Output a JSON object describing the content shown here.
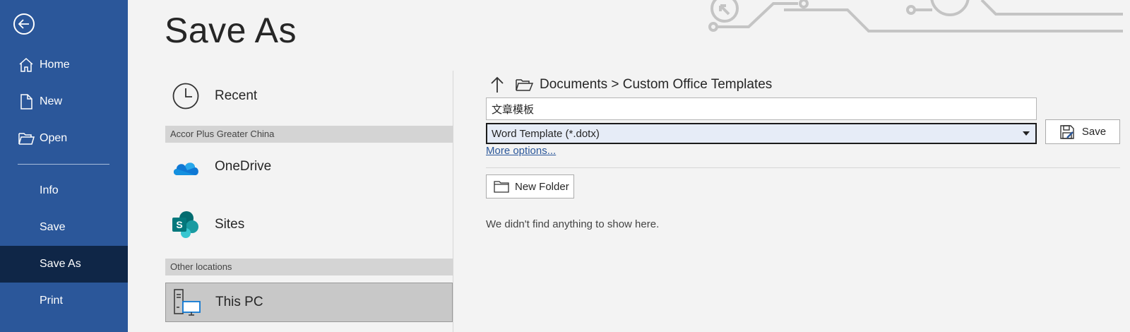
{
  "sidebar": {
    "items": [
      {
        "label": "Home",
        "icon": "home-icon"
      },
      {
        "label": "New",
        "icon": "new-document-icon"
      },
      {
        "label": "Open",
        "icon": "open-folder-icon"
      },
      {
        "label": "Info"
      },
      {
        "label": "Save"
      },
      {
        "label": "Save As",
        "active": true
      },
      {
        "label": "Print"
      }
    ]
  },
  "page": {
    "title": "Save As"
  },
  "locations": {
    "recent": "Recent",
    "section_org": "Accor Plus Greater China",
    "onedrive": "OneDrive",
    "sites": "Sites",
    "section_other": "Other locations",
    "this_pc": "This PC"
  },
  "path": {
    "text": "Documents > Custom Office Templates"
  },
  "form": {
    "filename": "文章模板",
    "filetype": "Word Template (*.dotx)",
    "save_label": "Save",
    "more_options": "More options...",
    "new_folder": "New Folder",
    "empty_message": "We didn't find anything to show here."
  },
  "colors": {
    "sidebar": "#2b579a",
    "sidebar_active": "#0f2647",
    "link": "#2b579a",
    "onedrive_blue": "#0f78d4",
    "sharepoint_teal": "#036c70"
  }
}
